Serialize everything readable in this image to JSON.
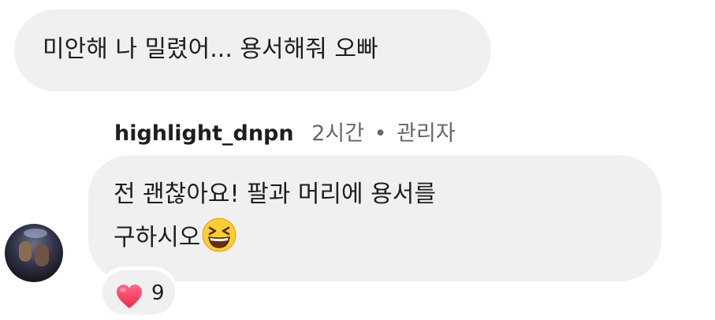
{
  "comment_1": {
    "text": "미안해 나 밀렸어... 용서해줘 오빠"
  },
  "reply": {
    "username": "highlight_dnpn",
    "time": "2시간",
    "separator": "•",
    "role": "관리자",
    "text_line1": "전 괜찮아요! 팔과 머리에 용서를",
    "text_line2": "구하시오",
    "emoji": "grinning-squinting-face-emoji"
  },
  "reaction": {
    "icon": "heart-icon",
    "count": "9",
    "color": "#ff3b5c"
  },
  "colors": {
    "bubble": "#f0f0f0",
    "meta_text": "#65676b",
    "text": "#1c1e21"
  }
}
